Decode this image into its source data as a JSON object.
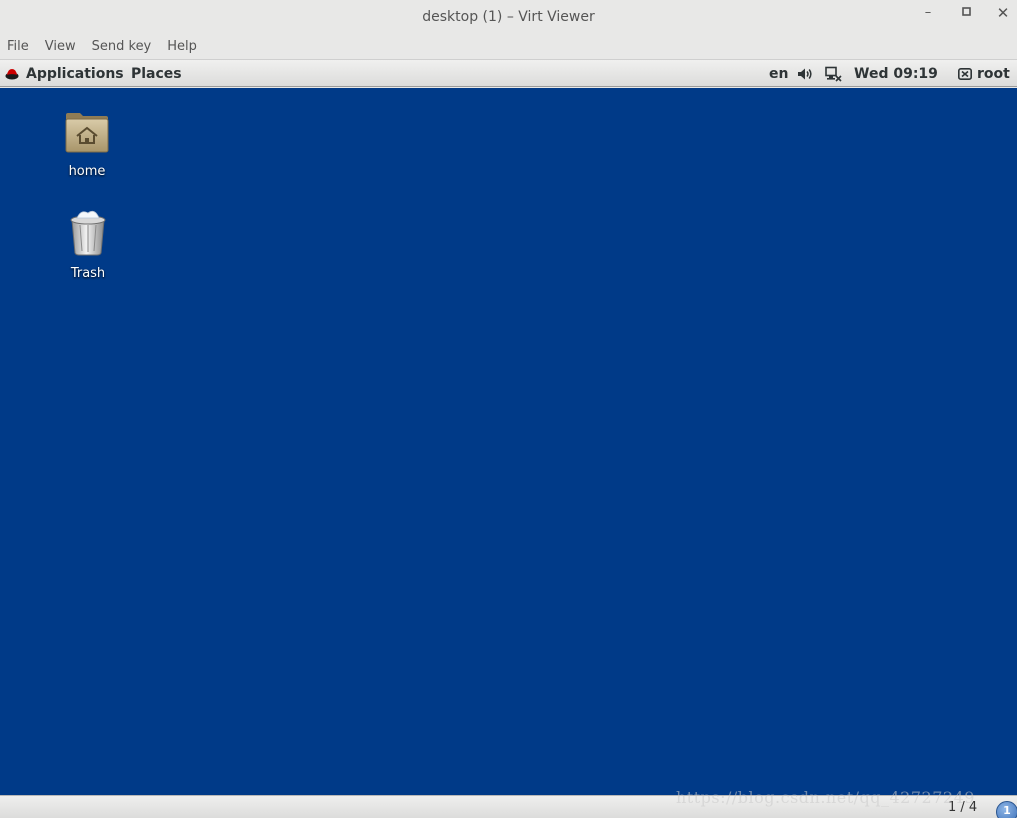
{
  "window": {
    "title": "desktop (1) – Virt Viewer",
    "minimize_icon": "minimize-icon",
    "maximize_icon": "maximize-icon",
    "close_icon": "close-icon"
  },
  "menubar": {
    "items": [
      "File",
      "View",
      "Send key",
      "Help"
    ]
  },
  "panel": {
    "applications_label": "Applications",
    "places_label": "Places",
    "language": "en",
    "clock": "Wed 09:19",
    "user": "root"
  },
  "desktop": {
    "background_color": "#003a88",
    "icons": [
      {
        "label": "home",
        "icon": "home-folder-icon"
      },
      {
        "label": "Trash",
        "icon": "trash-icon"
      }
    ]
  },
  "bottombar": {
    "workspace": "1 / 4",
    "notification_count": "1"
  },
  "watermark": "https://blog.csdn.net/qq_42727249"
}
